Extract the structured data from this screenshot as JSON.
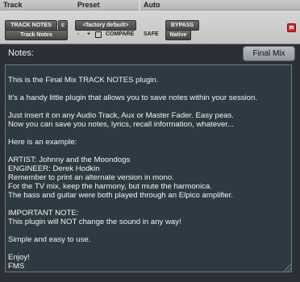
{
  "header": {
    "track_label": "Track",
    "preset_label": "Preset",
    "auto_label": "Auto"
  },
  "track": {
    "name": "TRACK NOTES",
    "channel": "c",
    "plugin": "Track Notes"
  },
  "preset": {
    "selected": "<factory default>",
    "minus": "-",
    "plus": "+",
    "compare_label": "COMPARE"
  },
  "auto": {
    "safe_label": "SAFE"
  },
  "controls": {
    "bypass_label": "BYPASS",
    "native_label": "Native"
  },
  "plugin": {
    "notes_label": "Notes:",
    "final_mix_label": "Final Mix",
    "notes_text": "This is the Final Mix TRACK NOTES plugin.\n\nIt's a handy little plugin that allows you to save notes within your session.\n\nJust insert it on any Audio Track, Aux or Master Fader. Easy peas.\nNow you can save you notes, lyrics, recall information, whatever...\n\nHere is an example:\n\nARTIST: Johnny and the Moondogs\nENGINEER: Derek Hodkin\nRemember to print an alternate version in mono.\nFor the TV mix, keep the harmony, but mute the harmonica.\nThe bass and guitar were both played through an Elpico amplifier.\n\nIMPORTANT NOTE:\nThis plugin will NOT change the sound in any way!\n\nSimple and easy to use.\n\nEnjoy!\nFMS"
  },
  "colors": {
    "panel_bg": "#2b3036",
    "notes_bg": "#2d3a42",
    "header_bg": "#c9c9c9",
    "accent_red": "#d52929"
  },
  "icons": [
    "chevron-down-icon",
    "link-icon",
    "delete-icon",
    "resize-grip-icon"
  ]
}
